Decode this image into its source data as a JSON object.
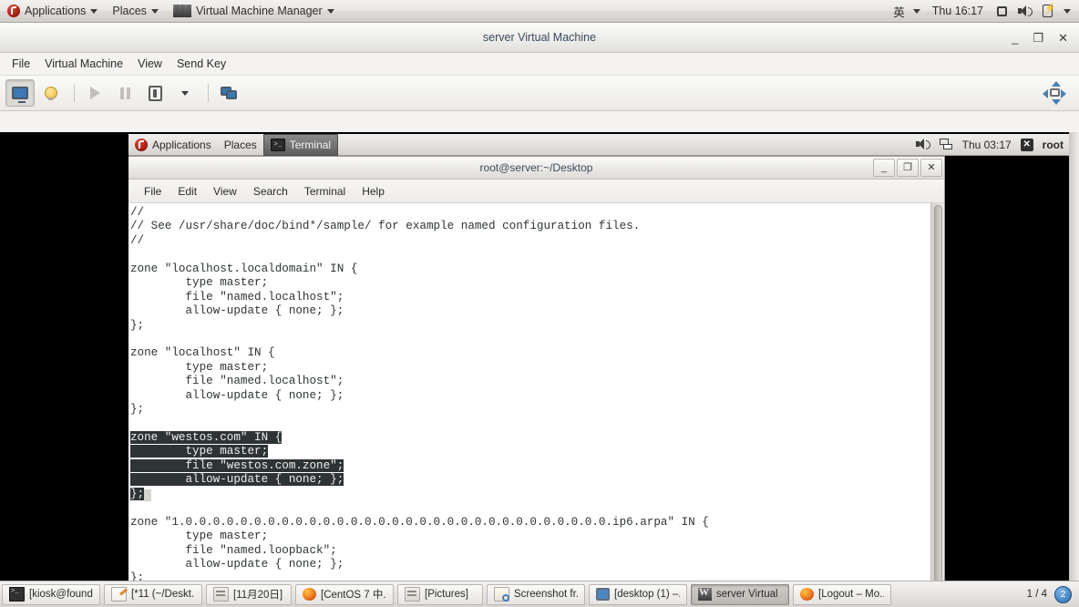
{
  "host_panel": {
    "applications": "Applications",
    "places": "Places",
    "active_app": "Virtual Machine Manager",
    "input_method": "英",
    "clock": "Thu 16:17"
  },
  "vmm_window": {
    "title": "server Virtual Machine",
    "minimize": "_",
    "maximize": "❐",
    "close": "✕",
    "menu": [
      "File",
      "Virtual Machine",
      "View",
      "Send Key"
    ],
    "toolbar_icons": [
      "console-view-icon",
      "details-lightbulb-icon",
      "run-icon",
      "pause-icon",
      "shutdown-icon",
      "shutdown-dropdown-icon",
      "snapshots-icon"
    ],
    "fullscreen_icon": "fullscreen-icon"
  },
  "guest_panel": {
    "applications": "Applications",
    "places": "Places",
    "window_button": "Terminal",
    "clock": "Thu 03:17",
    "user": "root"
  },
  "terminal": {
    "title": "root@server:~/Desktop",
    "minimize": "_",
    "maximize": "❐",
    "close": "✕",
    "menu": [
      "File",
      "Edit",
      "View",
      "Search",
      "Terminal",
      "Help"
    ],
    "lines": [
      {
        "text": "//",
        "selected": false
      },
      {
        "text": "// See /usr/share/doc/bind*/sample/ for example named configuration files.",
        "selected": false
      },
      {
        "text": "//",
        "selected": false
      },
      {
        "text": "",
        "selected": false
      },
      {
        "text": "zone \"localhost.localdomain\" IN {",
        "selected": false
      },
      {
        "text": "        type master;",
        "selected": false
      },
      {
        "text": "        file \"named.localhost\";",
        "selected": false
      },
      {
        "text": "        allow-update { none; };",
        "selected": false
      },
      {
        "text": "};",
        "selected": false
      },
      {
        "text": "",
        "selected": false
      },
      {
        "text": "zone \"localhost\" IN {",
        "selected": false
      },
      {
        "text": "        type master;",
        "selected": false
      },
      {
        "text": "        file \"named.localhost\";",
        "selected": false
      },
      {
        "text": "        allow-update { none; };",
        "selected": false
      },
      {
        "text": "};",
        "selected": false
      },
      {
        "text": "",
        "selected": false
      },
      {
        "text": "zone \"westos.com\" IN {",
        "selected": true
      },
      {
        "text": "        type master;",
        "selected": true
      },
      {
        "text": "        file \"westos.com.zone\";",
        "selected": true
      },
      {
        "text": "        allow-update { none; };",
        "selected": true
      },
      {
        "text": "};",
        "selected": true,
        "cursor": true
      },
      {
        "text": "",
        "selected": false
      },
      {
        "text": "zone \"1.0.0.0.0.0.0.0.0.0.0.0.0.0.0.0.0.0.0.0.0.0.0.0.0.0.0.0.0.0.0.0.ip6.arpa\" IN {",
        "selected": false
      },
      {
        "text": "        type master;",
        "selected": false
      },
      {
        "text": "        file \"named.loopback\";",
        "selected": false
      },
      {
        "text": "        allow-update { none; };",
        "selected": false
      },
      {
        "text": "};",
        "selected": false
      }
    ]
  },
  "taskbar": {
    "items": [
      {
        "icon": "terminal-icon",
        "label": "[kiosk@found...",
        "active": false
      },
      {
        "icon": "text-editor-icon",
        "label": "[*11 (~/Deskt...",
        "active": false
      },
      {
        "icon": "archive-icon",
        "label": "[11月20日]",
        "active": false
      },
      {
        "icon": "firefox-icon",
        "label": "[CentOS 7 中...",
        "active": false
      },
      {
        "icon": "archive-icon",
        "label": "[Pictures]",
        "active": false
      },
      {
        "icon": "screenshot-icon",
        "label": "Screenshot fr...",
        "active": false
      },
      {
        "icon": "monitor-icon",
        "label": "[desktop (1) –...",
        "active": false
      },
      {
        "icon": "vmm-icon",
        "label": "server Virtual ...",
        "active": true
      },
      {
        "icon": "firefox-icon",
        "label": "[Logout – Mo...",
        "active": false
      }
    ],
    "workspace_label": "1 / 4",
    "notification_count": "2"
  },
  "colors": {
    "terminal_bg": "#ffffff",
    "terminal_fg": "#2e3436",
    "selection_bg": "#2e3436",
    "selection_fg": "#eeeeec",
    "accent": "#3b78b5"
  }
}
